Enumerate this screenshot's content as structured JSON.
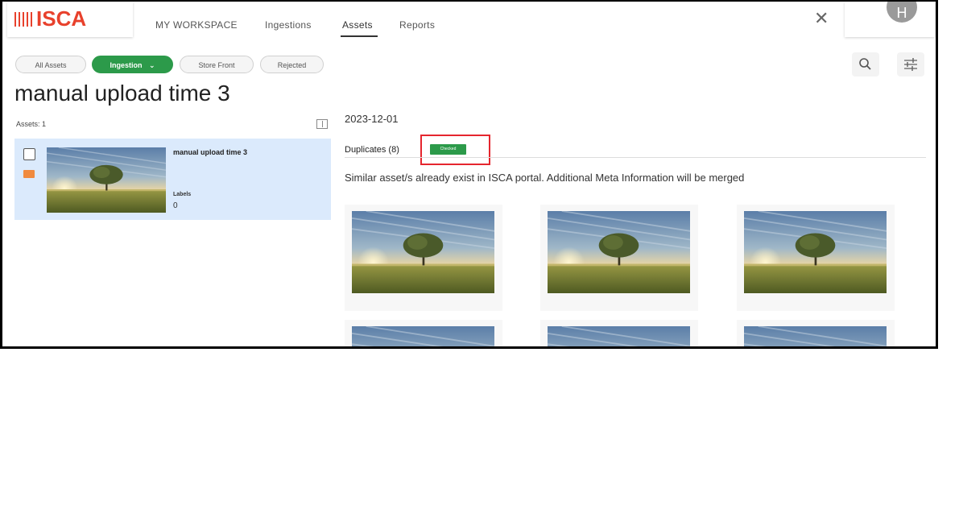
{
  "app": {
    "logo": "ISCA"
  },
  "nav": {
    "items": [
      "MY WORKSPACE",
      "Ingestions",
      "Assets",
      "Reports"
    ],
    "active": "Assets"
  },
  "user": {
    "initial": "H"
  },
  "filters": [
    "All Assets",
    "Ingestion",
    "Store Front",
    "Rejected"
  ],
  "page": {
    "title": "manual upload time 3",
    "assets_count": "Assets: 1"
  },
  "asset": {
    "name": "manual upload time 3",
    "labels_key": "Labels",
    "labels_value": "0"
  },
  "detail": {
    "date": "2023-12-01",
    "tab_label": "Duplicates (8)",
    "badge": "Checked",
    "info": "Similar asset/s already exist in ISCA portal. Additional Meta Information will be merged"
  },
  "colors": {
    "brand": "#e8412c",
    "accent_green": "#2c9a4a",
    "highlight": "#e5262e",
    "selected_bg": "#dbeafc"
  },
  "icons": [
    "close-icon",
    "search-icon",
    "filter-sliders-icon",
    "chevron-down-icon",
    "panel-collapse-icon",
    "image-type-icon"
  ]
}
